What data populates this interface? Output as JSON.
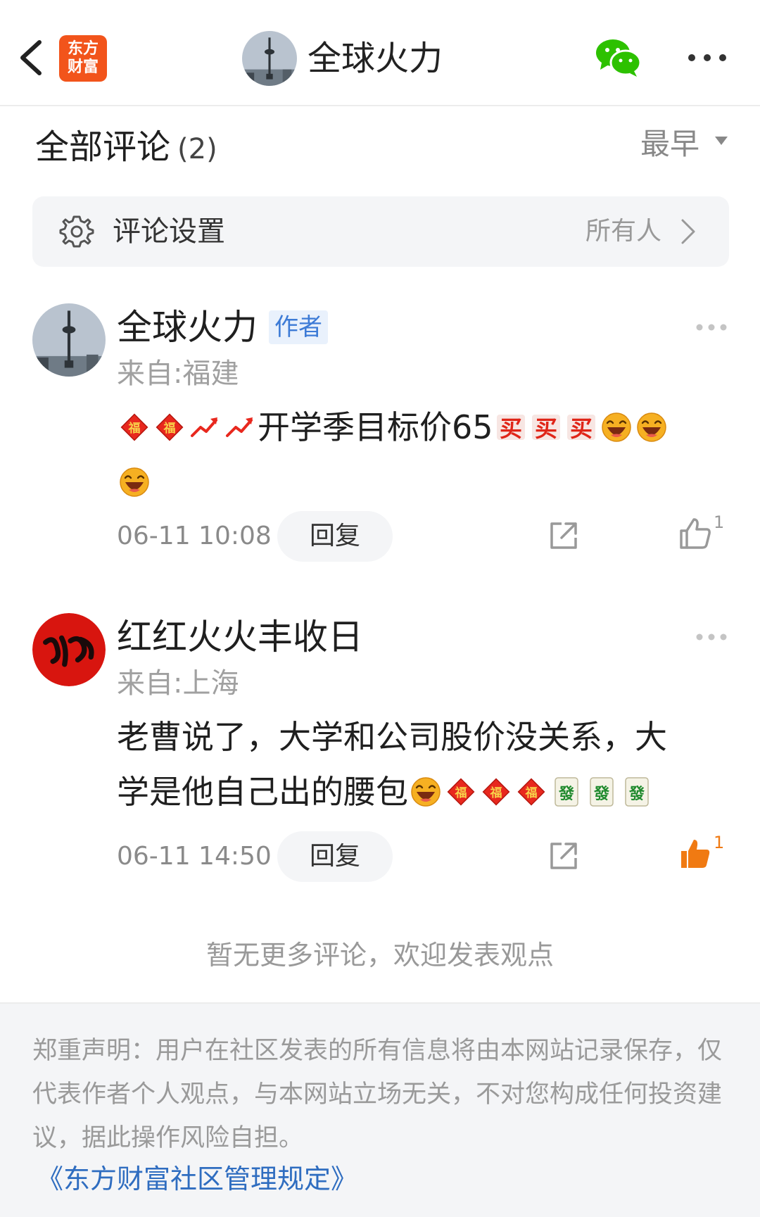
{
  "header": {
    "logo_line1": "东方",
    "logo_line2": "财富",
    "title": "全球火力",
    "back_icon": "chevron-left-icon",
    "share_icon": "wechat-icon",
    "more_icon": "more-horizontal-icon"
  },
  "comments_section": {
    "title": "全部评论",
    "count": "(2)",
    "sort_label": "最早"
  },
  "settings": {
    "label": "评论设置",
    "value": "所有人"
  },
  "comments": [
    {
      "name": "全球火力",
      "badge": "作者",
      "location": "来自:福建",
      "text": "开学季目标价65",
      "time": "06-11 10:08",
      "reply_label": "回复",
      "likes": "1",
      "liked": false
    },
    {
      "name": "红红火火丰收日",
      "location": "来自:上海",
      "text_line1": "老曹说了，大学和公司股价没关系，大",
      "text_line2": "学是他自己出的腰包",
      "time": "06-11 14:50",
      "reply_label": "回复",
      "likes": "1",
      "liked": true
    }
  ],
  "no_more": "暂无更多评论，欢迎发表观点",
  "footer": {
    "disclaimer": "郑重声明：用户在社区发表的所有信息将由本网站记录保存，仅代表作者个人观点，与本网站立场无关，不对您构成任何投资建议，据此操作风险自担。",
    "rules_link": "《东方财富社区管理规定》"
  },
  "colors": {
    "brand_orange": "#f2541b",
    "link_blue": "#2f6dc0",
    "like_orange": "#f07a12",
    "wechat_green": "#2dc100"
  }
}
